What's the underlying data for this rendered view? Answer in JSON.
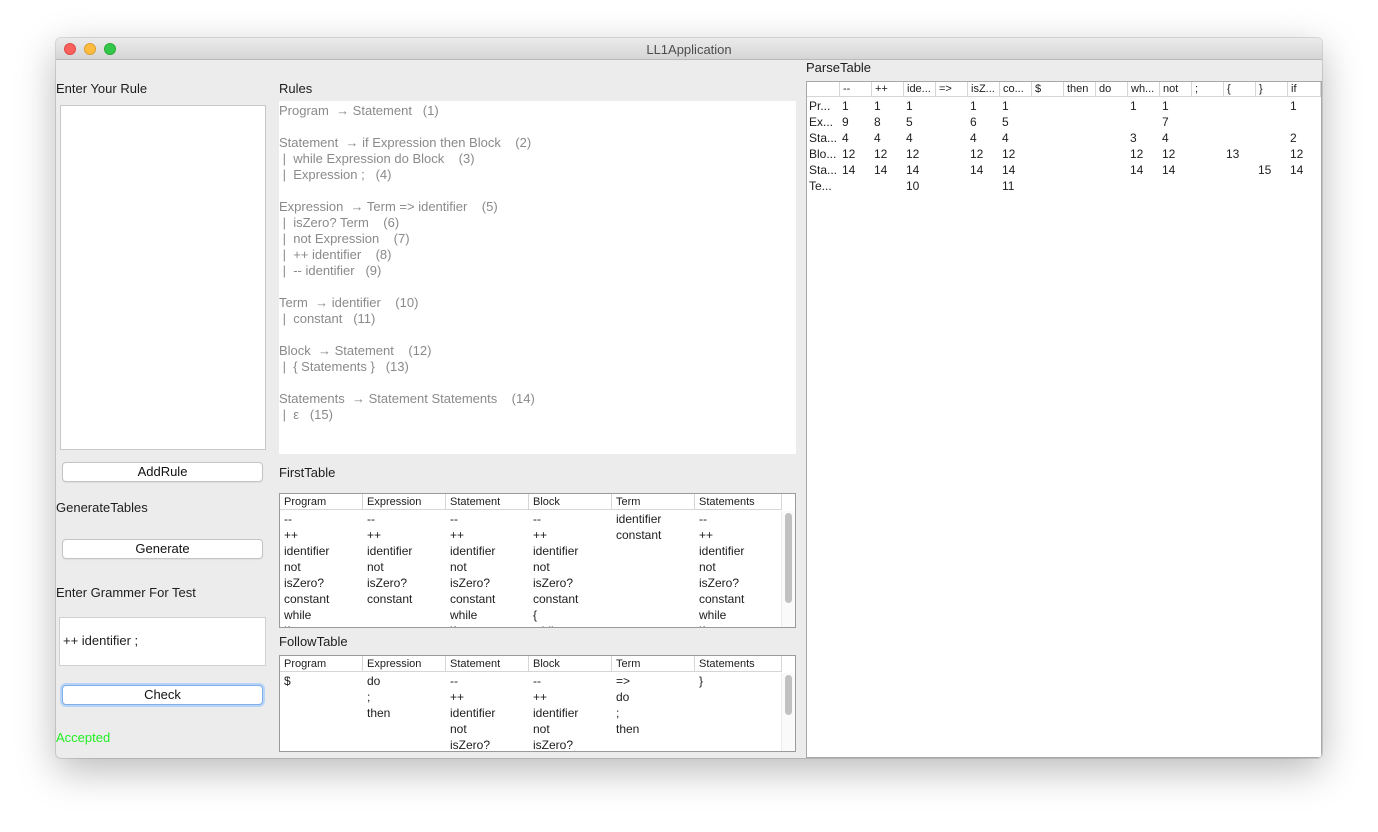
{
  "window": {
    "title": "LL1Application"
  },
  "left": {
    "enter_rule_label": "Enter Your Rule",
    "add_rule_button": "AddRule",
    "generate_tables_label": "GenerateTables",
    "generate_button": "Generate",
    "enter_grammar_label": "Enter Grammer For Test",
    "test_input_value": "++ identifier ;",
    "check_button": "Check",
    "result_text": "Accepted",
    "result_color": "#22ee22"
  },
  "rules": {
    "label": "Rules",
    "lines": [
      "Program  → Statement   (1)",
      "",
      "Statement  → if Expression then Block    (2)",
      " |  while Expression do Block    (3)",
      " |  Expression ;   (4)",
      "",
      "Expression  → Term => identifier    (5)",
      " |  isZero? Term    (6)",
      " |  not Expression    (7)",
      " |  ++ identifier    (8)",
      " |  -- identifier   (9)",
      "",
      "Term  → identifier    (10)",
      " |  constant   (11)",
      "",
      "Block  → Statement    (12)",
      " |  { Statements }   (13)",
      "",
      "Statements  → Statement Statements    (14)",
      " |  ε   (15)"
    ]
  },
  "first_table": {
    "label": "FirstTable",
    "headers": [
      "Program",
      "Expression",
      "Statement",
      "Block",
      "Term",
      "Statements"
    ],
    "columns": [
      [
        "--",
        "++",
        "identifier",
        "not",
        "isZero?",
        "constant",
        "while",
        "if"
      ],
      [
        "--",
        "++",
        "identifier",
        "not",
        "isZero?",
        "constant"
      ],
      [
        "--",
        "++",
        "identifier",
        "not",
        "isZero?",
        "constant",
        "while",
        "if"
      ],
      [
        "--",
        "++",
        "identifier",
        "not",
        "isZero?",
        "constant",
        "{",
        "while"
      ],
      [
        "identifier",
        "constant"
      ],
      [
        "--",
        "++",
        "identifier",
        "not",
        "isZero?",
        "constant",
        "while",
        "if"
      ]
    ]
  },
  "follow_table": {
    "label": "FollowTable",
    "headers": [
      "Program",
      "Expression",
      "Statement",
      "Block",
      "Term",
      "Statements"
    ],
    "columns": [
      [
        "$"
      ],
      [
        "do",
        ";",
        "then"
      ],
      [
        "--",
        "++",
        "identifier",
        "not",
        "isZero?"
      ],
      [
        "--",
        "++",
        "identifier",
        "not",
        "isZero?"
      ],
      [
        "=>",
        "do",
        ";",
        "then"
      ],
      [
        "}"
      ]
    ]
  },
  "parse_table": {
    "label": "ParseTable",
    "headers": [
      "",
      "--",
      "++",
      "ide...",
      "=>",
      "isZ...",
      "co...",
      "$",
      "then",
      "do",
      "wh...",
      "not",
      ";",
      "{",
      "}",
      "if"
    ],
    "rows": [
      [
        "Pr...",
        "1",
        "1",
        "1",
        "",
        "1",
        "1",
        "",
        "",
        "",
        "1",
        "1",
        "",
        "",
        "",
        "1"
      ],
      [
        "Ex...",
        "9",
        "8",
        "5",
        "",
        "6",
        "5",
        "",
        "",
        "",
        "",
        "7",
        "",
        "",
        "",
        ""
      ],
      [
        "Sta...",
        "4",
        "4",
        "4",
        "",
        "4",
        "4",
        "",
        "",
        "",
        "3",
        "4",
        "",
        "",
        "",
        "2"
      ],
      [
        "Blo...",
        "12",
        "12",
        "12",
        "",
        "12",
        "12",
        "",
        "",
        "",
        "12",
        "12",
        "",
        "13",
        "",
        "12"
      ],
      [
        "Sta...",
        "14",
        "14",
        "14",
        "",
        "14",
        "14",
        "",
        "",
        "",
        "14",
        "14",
        "",
        "",
        "15",
        "14"
      ],
      [
        "Te...",
        "",
        "",
        "10",
        "",
        "",
        "11",
        "",
        "",
        "",
        "",
        "",
        "",
        "",
        "",
        ""
      ]
    ]
  }
}
